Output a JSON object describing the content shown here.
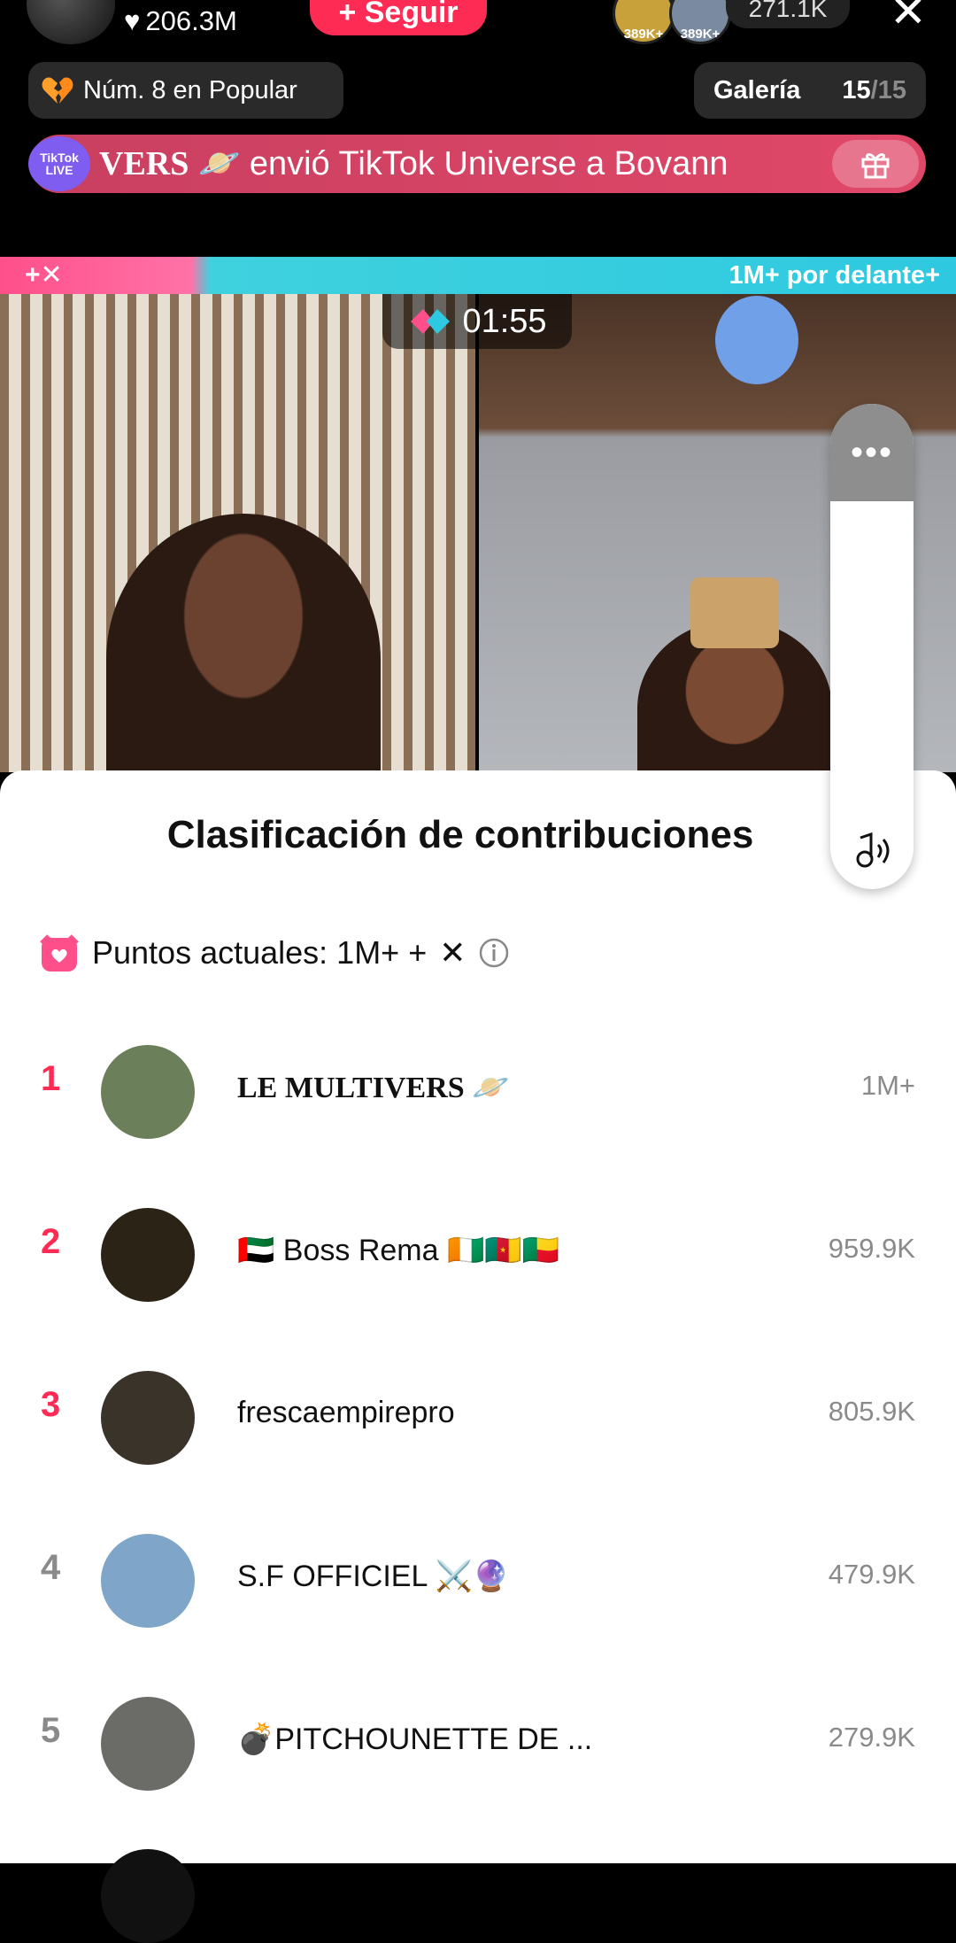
{
  "header": {
    "likes": "206.3M",
    "follow_label": "+ Seguir",
    "viewer_badges": [
      "389K+",
      "389K+"
    ],
    "viewer_count": "271.1K",
    "close": "✕"
  },
  "ranking_pill": "Núm. 8 en Popular",
  "gallery": {
    "label": "Galería",
    "current": "15",
    "total": "/15"
  },
  "gift_banner": {
    "badge": "TikTok LIVE",
    "sender": "VERS",
    "message": "envió TikTok Universe a Bovann"
  },
  "battle": {
    "left_label": "+✕",
    "right_label": "1M+ por delante+",
    "timer": "01:55"
  },
  "side_control": {
    "more": "•••"
  },
  "sheet": {
    "title": "Clasificación de contribuciones",
    "points_label": "Puntos actuales: 1M+ +",
    "points_x": "✕",
    "rows": [
      {
        "rank": "1",
        "name": "LE MULTIVERS 🪐",
        "score": "1M+",
        "avatar_color": "#6a7f5a"
      },
      {
        "rank": "2",
        "name": "🇦🇪 Boss Rema 🇨🇮🇨🇲🇧🇯",
        "score": "959.9K",
        "avatar_color": "#2b2416"
      },
      {
        "rank": "3",
        "name": "frescaempirepro",
        "score": "805.9K",
        "avatar_color": "#3a332a"
      },
      {
        "rank": "4",
        "name": "S.F OFFICIEL ⚔️🔮",
        "score": "479.9K",
        "avatar_color": "#7fa6c9"
      },
      {
        "rank": "5",
        "name": "💣PITCHOUNETTE DE ...",
        "score": "279.9K",
        "avatar_color": "#6b6b68"
      }
    ]
  },
  "colors": {
    "accent": "#fe2c55",
    "muted": "#8a8a8a",
    "battle_pink": "#ff4f8a",
    "battle_cyan": "#2ec9e0"
  }
}
